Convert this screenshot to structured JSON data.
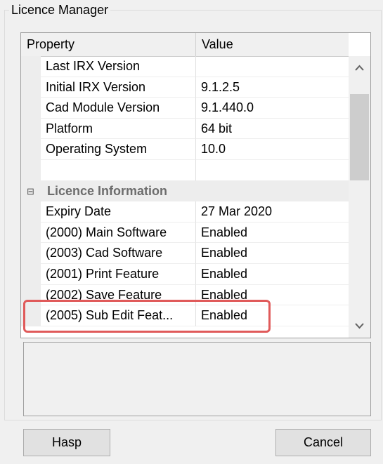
{
  "group_title": "Licence Manager",
  "grid": {
    "header": {
      "property": "Property",
      "value": "Value"
    },
    "rows": [
      {
        "property": "Last IRX Version",
        "value": ""
      },
      {
        "property": "Initial IRX Version",
        "value": "9.1.2.5"
      },
      {
        "property": "Cad Module Version",
        "value": "9.1.440.0"
      },
      {
        "property": "Platform",
        "value": "64 bit"
      },
      {
        "property": "Operating System",
        "value": "10.0"
      },
      {
        "property": "",
        "value": ""
      },
      {
        "category": "Licence Information",
        "expander": "⊟"
      },
      {
        "property": "Expiry Date",
        "value": "27 Mar 2020"
      },
      {
        "property": "(2000) Main Software",
        "value": "Enabled"
      },
      {
        "property": "(2003) Cad Software",
        "value": "Enabled"
      },
      {
        "property": "(2001) Print Feature",
        "value": "Enabled"
      },
      {
        "property": "(2002) Save Feature",
        "value": "Enabled"
      },
      {
        "property": "(2005) Sub Edit Feat...",
        "value": "Enabled"
      }
    ]
  },
  "scroll": {
    "up_icon": "chevron-up-icon",
    "down_icon": "chevron-down-icon"
  },
  "buttons": {
    "hasp": "Hasp",
    "cancel": "Cancel"
  },
  "colors": {
    "highlight": "#e05a5a"
  }
}
